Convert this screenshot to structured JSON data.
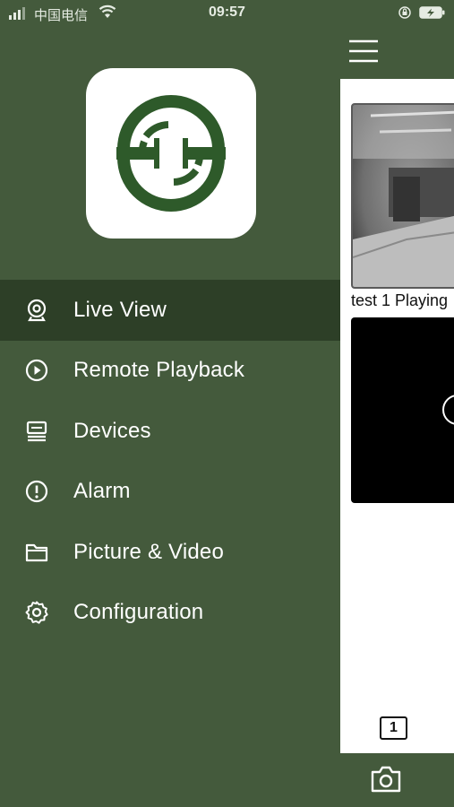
{
  "status_bar": {
    "carrier": "中国电信",
    "time": "09:57"
  },
  "icons": {
    "signal": "signal-icon",
    "wifi": "wifi-icon",
    "orientation_lock": "orientation-lock-icon",
    "battery": "battery-charging-icon",
    "logo": "app-logo",
    "hamburger": "menu-icon",
    "camera": "camera-icon"
  },
  "menu": {
    "items": [
      {
        "label": "Live View",
        "icon": "webcam-icon",
        "active": true
      },
      {
        "label": "Remote Playback",
        "icon": "play-circle-icon",
        "active": false
      },
      {
        "label": "Devices",
        "icon": "device-icon",
        "active": false
      },
      {
        "label": "Alarm",
        "icon": "alert-circle-icon",
        "active": false
      },
      {
        "label": "Picture & Video",
        "icon": "folder-icon",
        "active": false
      },
      {
        "label": "Configuration",
        "icon": "settings-gear-icon",
        "active": false
      }
    ]
  },
  "content": {
    "channel_1_label": "test 1 Playing",
    "page_indicator": "1"
  },
  "colors": {
    "drawer_background": "#445a3c",
    "active_item_background": "#2d3f27",
    "logo_green": "#2e5a2a",
    "text": "#ffffff"
  }
}
